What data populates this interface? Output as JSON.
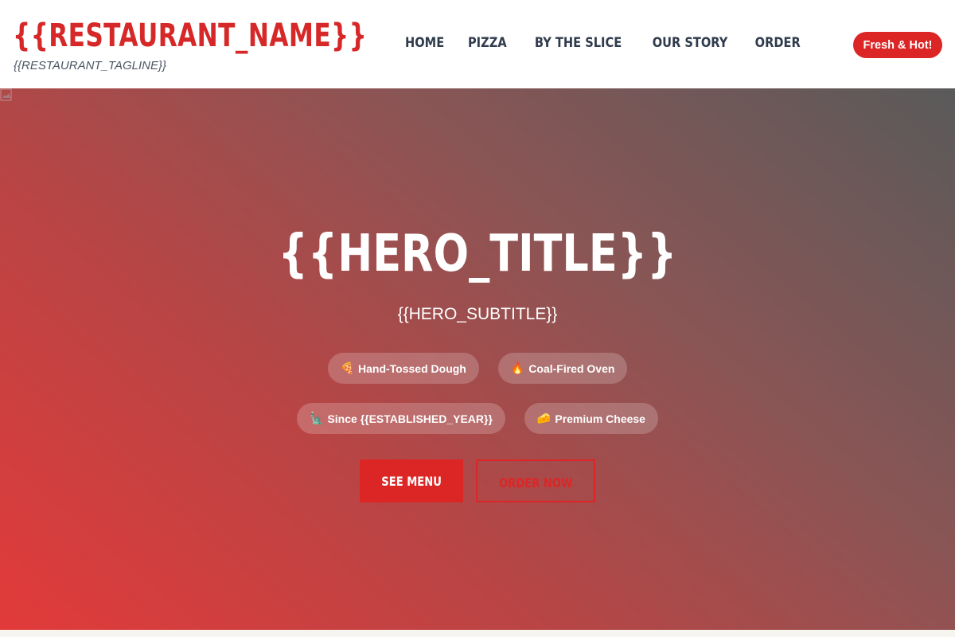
{
  "header": {
    "restaurant_name": "{{RESTAURANT_NAME}}",
    "tagline": "{{RESTAURANT_TAGLINE}}",
    "nav": [
      {
        "label": "HOME"
      },
      {
        "label": "PIZZA"
      },
      {
        "label": "BY THE SLICE"
      },
      {
        "label": "OUR STORY"
      },
      {
        "label": "ORDER"
      }
    ],
    "badge": "Fresh & Hot!"
  },
  "hero": {
    "broken_image_icon": "broken-image-icon",
    "title": "{{HERO_TITLE}}",
    "subtitle": "{{HERO_SUBTITLE}}",
    "features": [
      {
        "emoji": "🍕",
        "label": "Hand-Tossed Dough"
      },
      {
        "emoji": "🔥",
        "label": "Coal-Fired Oven"
      },
      {
        "emoji": "🗽",
        "label": "Since {{ESTABLISHED_YEAR}}"
      },
      {
        "emoji": "🧀",
        "label": "Premium Cheese"
      }
    ],
    "primary_cta": "SEE MENU",
    "secondary_cta": "ORDER NOW"
  },
  "colors": {
    "brand_red": "#dc2626",
    "nav_text": "#2f3b4c",
    "hero_gradient_start": "#e23a3a",
    "hero_gradient_end": "#5a5a5a"
  }
}
